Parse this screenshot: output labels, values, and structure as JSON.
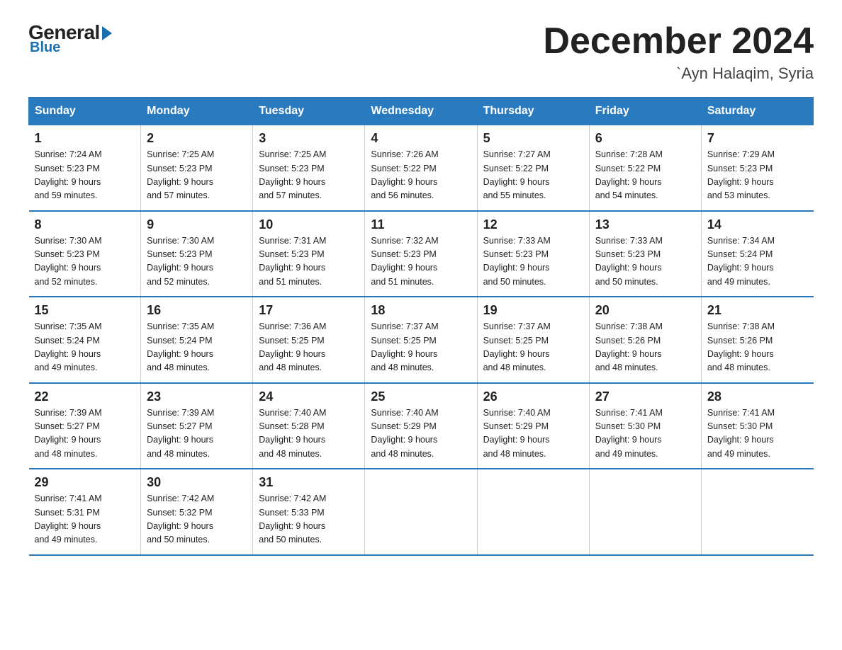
{
  "logo": {
    "general": "General",
    "blue": "Blue"
  },
  "header": {
    "month": "December 2024",
    "location": "`Ayn Halaqim, Syria"
  },
  "weekdays": [
    "Sunday",
    "Monday",
    "Tuesday",
    "Wednesday",
    "Thursday",
    "Friday",
    "Saturday"
  ],
  "weeks": [
    [
      {
        "day": "1",
        "sunrise": "7:24 AM",
        "sunset": "5:23 PM",
        "daylight": "9 hours and 59 minutes."
      },
      {
        "day": "2",
        "sunrise": "7:25 AM",
        "sunset": "5:23 PM",
        "daylight": "9 hours and 57 minutes."
      },
      {
        "day": "3",
        "sunrise": "7:25 AM",
        "sunset": "5:23 PM",
        "daylight": "9 hours and 57 minutes."
      },
      {
        "day": "4",
        "sunrise": "7:26 AM",
        "sunset": "5:22 PM",
        "daylight": "9 hours and 56 minutes."
      },
      {
        "day": "5",
        "sunrise": "7:27 AM",
        "sunset": "5:22 PM",
        "daylight": "9 hours and 55 minutes."
      },
      {
        "day": "6",
        "sunrise": "7:28 AM",
        "sunset": "5:22 PM",
        "daylight": "9 hours and 54 minutes."
      },
      {
        "day": "7",
        "sunrise": "7:29 AM",
        "sunset": "5:23 PM",
        "daylight": "9 hours and 53 minutes."
      }
    ],
    [
      {
        "day": "8",
        "sunrise": "7:30 AM",
        "sunset": "5:23 PM",
        "daylight": "9 hours and 52 minutes."
      },
      {
        "day": "9",
        "sunrise": "7:30 AM",
        "sunset": "5:23 PM",
        "daylight": "9 hours and 52 minutes."
      },
      {
        "day": "10",
        "sunrise": "7:31 AM",
        "sunset": "5:23 PM",
        "daylight": "9 hours and 51 minutes."
      },
      {
        "day": "11",
        "sunrise": "7:32 AM",
        "sunset": "5:23 PM",
        "daylight": "9 hours and 51 minutes."
      },
      {
        "day": "12",
        "sunrise": "7:33 AM",
        "sunset": "5:23 PM",
        "daylight": "9 hours and 50 minutes."
      },
      {
        "day": "13",
        "sunrise": "7:33 AM",
        "sunset": "5:23 PM",
        "daylight": "9 hours and 50 minutes."
      },
      {
        "day": "14",
        "sunrise": "7:34 AM",
        "sunset": "5:24 PM",
        "daylight": "9 hours and 49 minutes."
      }
    ],
    [
      {
        "day": "15",
        "sunrise": "7:35 AM",
        "sunset": "5:24 PM",
        "daylight": "9 hours and 49 minutes."
      },
      {
        "day": "16",
        "sunrise": "7:35 AM",
        "sunset": "5:24 PM",
        "daylight": "9 hours and 48 minutes."
      },
      {
        "day": "17",
        "sunrise": "7:36 AM",
        "sunset": "5:25 PM",
        "daylight": "9 hours and 48 minutes."
      },
      {
        "day": "18",
        "sunrise": "7:37 AM",
        "sunset": "5:25 PM",
        "daylight": "9 hours and 48 minutes."
      },
      {
        "day": "19",
        "sunrise": "7:37 AM",
        "sunset": "5:25 PM",
        "daylight": "9 hours and 48 minutes."
      },
      {
        "day": "20",
        "sunrise": "7:38 AM",
        "sunset": "5:26 PM",
        "daylight": "9 hours and 48 minutes."
      },
      {
        "day": "21",
        "sunrise": "7:38 AM",
        "sunset": "5:26 PM",
        "daylight": "9 hours and 48 minutes."
      }
    ],
    [
      {
        "day": "22",
        "sunrise": "7:39 AM",
        "sunset": "5:27 PM",
        "daylight": "9 hours and 48 minutes."
      },
      {
        "day": "23",
        "sunrise": "7:39 AM",
        "sunset": "5:27 PM",
        "daylight": "9 hours and 48 minutes."
      },
      {
        "day": "24",
        "sunrise": "7:40 AM",
        "sunset": "5:28 PM",
        "daylight": "9 hours and 48 minutes."
      },
      {
        "day": "25",
        "sunrise": "7:40 AM",
        "sunset": "5:29 PM",
        "daylight": "9 hours and 48 minutes."
      },
      {
        "day": "26",
        "sunrise": "7:40 AM",
        "sunset": "5:29 PM",
        "daylight": "9 hours and 48 minutes."
      },
      {
        "day": "27",
        "sunrise": "7:41 AM",
        "sunset": "5:30 PM",
        "daylight": "9 hours and 49 minutes."
      },
      {
        "day": "28",
        "sunrise": "7:41 AM",
        "sunset": "5:30 PM",
        "daylight": "9 hours and 49 minutes."
      }
    ],
    [
      {
        "day": "29",
        "sunrise": "7:41 AM",
        "sunset": "5:31 PM",
        "daylight": "9 hours and 49 minutes."
      },
      {
        "day": "30",
        "sunrise": "7:42 AM",
        "sunset": "5:32 PM",
        "daylight": "9 hours and 50 minutes."
      },
      {
        "day": "31",
        "sunrise": "7:42 AM",
        "sunset": "5:33 PM",
        "daylight": "9 hours and 50 minutes."
      },
      null,
      null,
      null,
      null
    ]
  ],
  "labels": {
    "sunrise": "Sunrise:",
    "sunset": "Sunset:",
    "daylight": "Daylight:"
  }
}
